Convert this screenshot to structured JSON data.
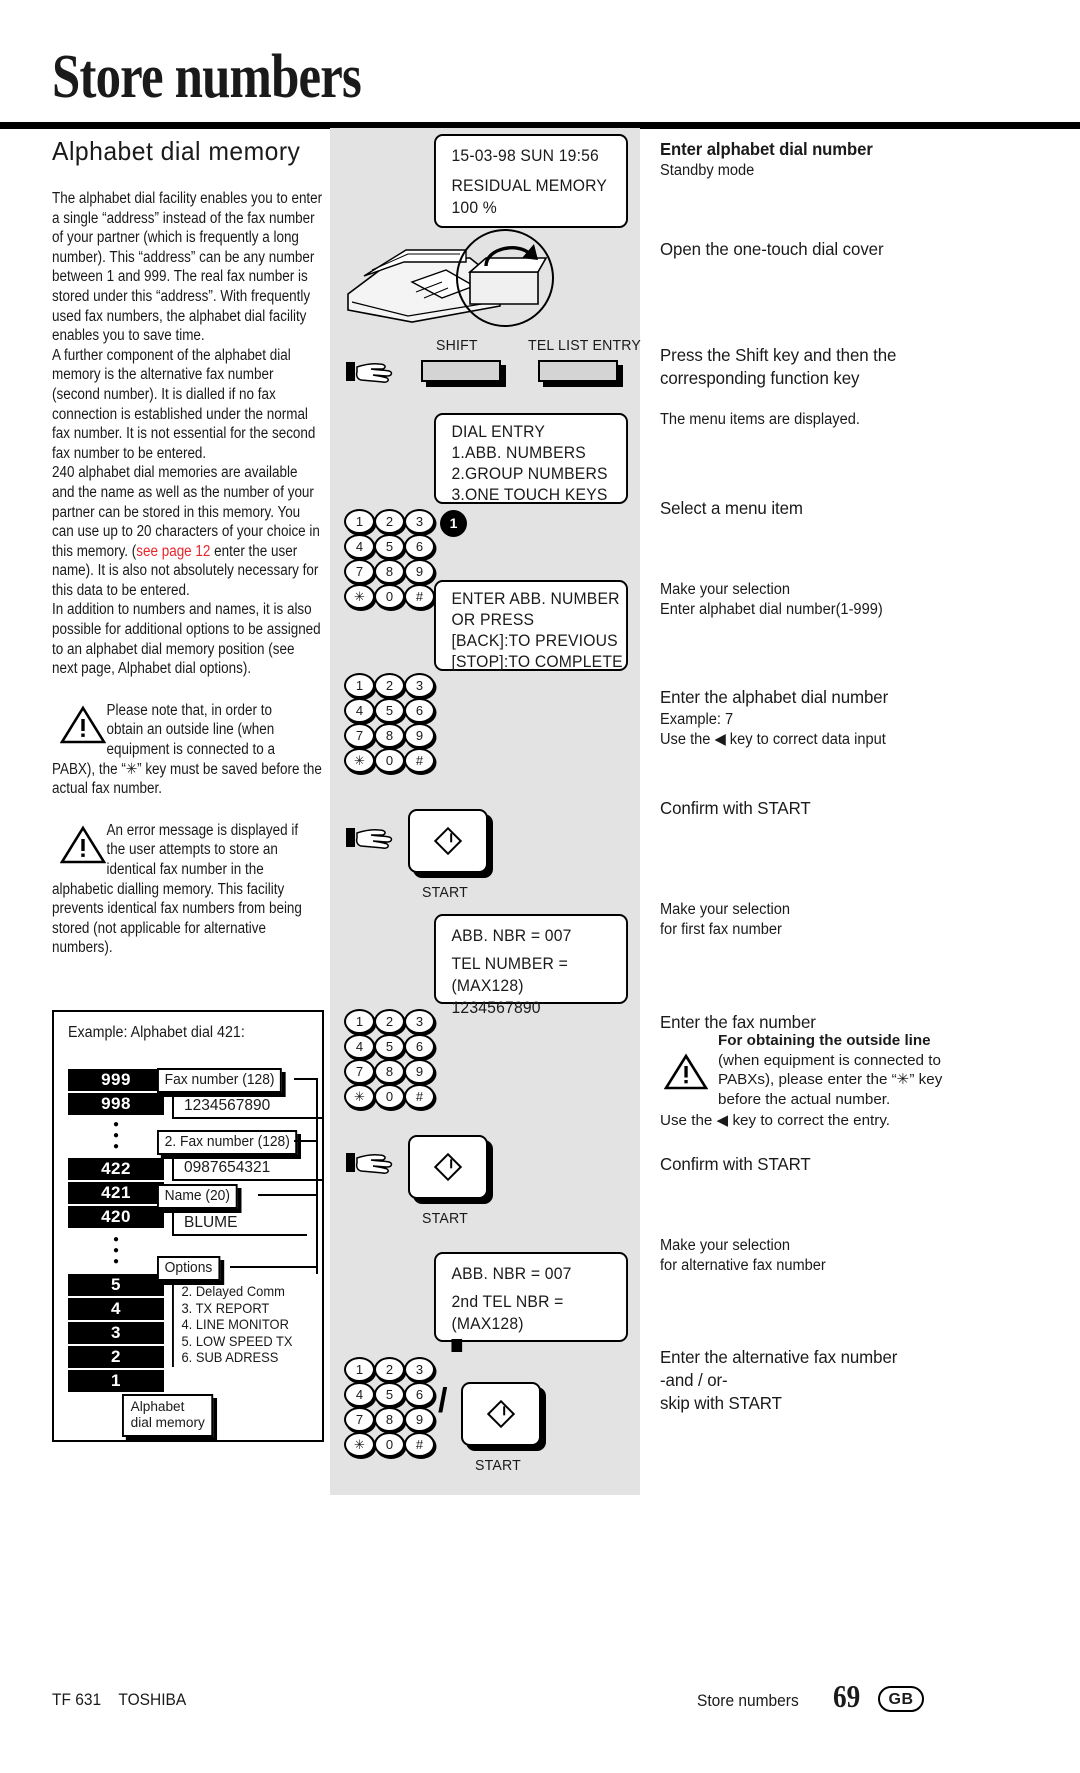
{
  "page": {
    "title": "Store numbers",
    "section_heading": "Alphabet  dial  memory"
  },
  "left_column": {
    "paragraph_1": "The alphabet dial facility enables you to enter a single “address” instead of the fax number of your partner (which is frequently a long number). This “address” can be any number between 1 and 999. The real fax number is stored under this “address”. With frequently used fax numbers, the alphabet dial facility enables you to save time.",
    "paragraph_2": "A further component of the alphabet dial memory is the alternative fax number (second number). It is dialled if no fax connection is established under the normal fax number. It is not essential for the second fax number to be entered.",
    "paragraph_3_pre": "240 alphabet dial memories are available and the name as well as the number of your partner can be stored in this memory. You can use up to 20 characters of your choice in this memory. (",
    "paragraph_3_link": "see page 12",
    "paragraph_3_post": " enter the user name). It is also not absolutely necessary for this data to be entered.",
    "paragraph_4": "In addition to numbers and names, it is also possible for additional options to be assigned to an alphabet dial memory position (see next page, Alphabet dial options).",
    "note_1_line_1": "Please note that, in order to",
    "note_1_line_2": "obtain an outside line (when",
    "note_1_line_3": "equipment is connected to a",
    "note_1_rest": "PABX), the “✳” key must be saved before the actual fax number.",
    "note_2_line_1": "An error message is displayed if",
    "note_2_line_2": "the user attempts to store an",
    "note_2_line_3": "identical fax number in the",
    "note_2_rest": "alphabetic dialling memory. This facility prevents identical fax numbers from being stored (not applicable for alternative numbers)."
  },
  "example_diagram": {
    "caption": "Example: Alphabet dial 421:",
    "addresses_top": [
      "999",
      "998"
    ],
    "addresses_mid": [
      "422",
      "421",
      "420"
    ],
    "addresses_bottom": [
      "5",
      "4",
      "3",
      "2",
      "1"
    ],
    "fields": [
      {
        "label": "Fax number (128)",
        "value": "1234567890"
      },
      {
        "label": "2. Fax number (128)",
        "value": "0987654321"
      },
      {
        "label": "Name (20)",
        "value": "BLUME"
      }
    ],
    "options_label": "Options",
    "options": [
      "2. Delayed Comm",
      "3. TX REPORT",
      "4. LINE MONITOR",
      "5. LOW SPEED TX",
      "6. SUB ADRESS"
    ],
    "memory_tag_line_1": "Alphabet",
    "memory_tag_line_2": "dial memory"
  },
  "center_column": {
    "display_standby_line_1": "15-03-98     SUN      19:56",
    "display_standby_line_2": "RESIDUAL  MEMORY 100 %",
    "shift_label": "SHIFT",
    "tel_list_label": "TEL LIST ENTRY",
    "display_dial_entry": [
      "DIAL ENTRY",
      "1.ABB. NUMBERS",
      "2.GROUP NUMBERS",
      "3.ONE TOUCH KEYS"
    ],
    "selected_key": "1",
    "display_enter_abb": [
      "ENTER ABB. NUMBER",
      "OR PRESS",
      "[BACK]:TO PREVIOUS",
      "[STOP]:TO COMPLETE"
    ],
    "start_label_1": "START",
    "display_first_number": [
      "ABB. NBR =        007",
      "TEL NUMBER = (MAX128)",
      "1234567890"
    ],
    "start_label_2": "START",
    "display_second_number": [
      "ABB. NBR =        007",
      "2nd TEL NBR = (MAX128)"
    ],
    "start_label_3": "START",
    "keypad_rows": [
      [
        "1",
        "2",
        "3"
      ],
      [
        "4",
        "5",
        "6"
      ],
      [
        "7",
        "8",
        "9"
      ],
      [
        "✳",
        "0",
        "#"
      ]
    ],
    "slash": "/"
  },
  "right_column": {
    "steps": [
      {
        "heading": "Enter alphabet dial number",
        "sub": "Standby mode"
      },
      {
        "heading": "Open the one-touch dial cover",
        "sub": ""
      },
      {
        "heading": "Press the Shift key and then the corresponding function key",
        "sub": "The menu items are displayed."
      },
      {
        "heading": "Select a menu item",
        "sub": "Make your selection\nEnter alphabet dial number(1-999)"
      },
      {
        "heading": "Enter the alphabet dial number",
        "sub": "Example: 7\nUse the ◀ key to correct data input"
      },
      {
        "heading": "Confirm with START",
        "sub": "Make your selection\nfor first fax number"
      },
      {
        "heading": "Enter the fax number",
        "sub": ""
      },
      {
        "heading": "Confirm with START",
        "sub": "Make your selection\nfor alternative fax number"
      },
      {
        "heading": "Enter the alternative fax number\n-and / or-\nskip with START",
        "sub": ""
      }
    ],
    "step3_note": "The menu items are displayed.",
    "step4_sub_1": "Make your selection",
    "step4_sub_2": "Enter alphabet dial number(1-999)",
    "step5_sub_1": "Example: 7",
    "step5_sub_2": "Use the ◀ key to correct data input",
    "step6_sub_1": "Make your selection",
    "step6_sub_2": "for first fax number",
    "step8_sub_1": "Make your selection",
    "step8_sub_2": "for alternative fax number",
    "fax_note_bold": "For obtaining the outside line",
    "fax_note_body": "(when equipment is connected to PABXs), please enter the “✳” key before the actual number.",
    "fax_note_tail": "Use the ◀ key to correct the entry.",
    "heading_1": "Enter alphabet dial number",
    "heading_2": "Open the one-touch dial cover",
    "heading_3": "Press the Shift key and then the corresponding function key",
    "heading_4": "Select a menu item",
    "heading_5": "Enter the alphabet dial number",
    "heading_6": "Confirm with START",
    "heading_7": "Enter the fax number",
    "heading_8": "Confirm with START",
    "heading_9_l1": "Enter the alternative fax number",
    "heading_9_l2": "-and / or-",
    "heading_9_l3": "skip with START"
  },
  "footer": {
    "model": "TF 631",
    "brand": "TOSHIBA",
    "section": "Store numbers",
    "page_number": "69",
    "region": "GB"
  }
}
